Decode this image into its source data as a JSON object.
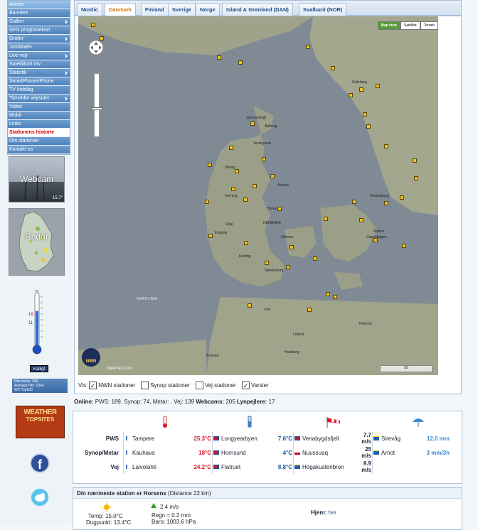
{
  "menu": {
    "items": [
      {
        "label": "Avisen",
        "arrow": false
      },
      {
        "label": "Bannere",
        "arrow": false
      },
      {
        "label": "Galleri",
        "arrow": true
      },
      {
        "label": "GFS prognosekort",
        "arrow": false
      },
      {
        "label": "Grafer",
        "arrow": true
      },
      {
        "label": "Jordskælv",
        "arrow": false
      },
      {
        "label": "Live vejr",
        "arrow": true
      },
      {
        "label": "Satellitkort mv.",
        "arrow": false
      },
      {
        "label": "Statistik",
        "arrow": true
      },
      {
        "label": "SmartPhone/iPhone",
        "arrow": false
      },
      {
        "label": "TV Indslag",
        "arrow": false
      },
      {
        "label": "Tilmeldte vejrsider",
        "arrow": true
      },
      {
        "label": "Video",
        "arrow": false
      },
      {
        "label": "Mobil",
        "arrow": false
      },
      {
        "label": "Links",
        "arrow": false
      },
      {
        "label": "Stationens historie",
        "arrow": false,
        "highlight": true
      },
      {
        "label": "Om stationen",
        "arrow": false
      },
      {
        "label": "Kontakt os",
        "arrow": false
      }
    ]
  },
  "sidebar": {
    "webcam_label": "Webcam",
    "webcam_temp": "15.7°",
    "radar_label": "Radar",
    "thermometer": {
      "unit": "°C",
      "max_value": "16",
      "min_value": "11",
      "level_value": 15
    },
    "kalibrate_label": "Kalligt",
    "hits_today": "Hits today: 309",
    "avg_hits": "Average hits: 1064",
    "hits_footer": "WX Top100",
    "topsites_line1": "WEATHER",
    "topsites_line2": "TOPSITES",
    "facebook_icon": "f"
  },
  "tabs": [
    "Nordic",
    "Danmark",
    "Finland",
    "Sverige",
    "Norge",
    "Island & Grønland (DAN)",
    "Svalbard (NOR)"
  ],
  "active_tab": "Danmark",
  "map": {
    "maptypes": [
      "Map view",
      "Satellite",
      "Terrain"
    ],
    "active_maptype": "Map view",
    "copyright": "©NAVTEQ 2010",
    "logo_text": "NWN",
    "scale_label": "50",
    "labels": [
      "Jammerbugt",
      "Aalborg",
      "Vendsyssel",
      "Viborg",
      "Aarhus",
      "Vejle",
      "Esbjerg",
      "Odense",
      "Horsens",
      "DENMARK",
      "Copenhagen",
      "Malmö",
      "Helsingborg",
      "Göteborg",
      "Kiel",
      "Lübeck",
      "Hamburg",
      "Rostock",
      "Bremen",
      "NORTH SEA",
      "Sønderborg",
      "Kolding",
      "Herning"
    ]
  },
  "layers": {
    "prefix": "Vis:",
    "items": [
      {
        "label": "NWN stationer",
        "checked": true
      },
      {
        "label": "Synop stationer",
        "checked": false
      },
      {
        "label": "Vej stationer",
        "checked": false
      },
      {
        "label": "Varsler",
        "checked": true
      }
    ]
  },
  "online": {
    "label": "Online:",
    "text": "PWS: 189, Synop: 74, Metar: , Vej: 139",
    "webcams_label": "Webcams:",
    "webcams_value": "205",
    "lightning_label": "Lynpejlere:",
    "lightning_value": "17"
  },
  "stats": {
    "icons": [
      "thermometer-icon",
      "rain-gauge-icon",
      "windsock-icon",
      "umbrella-icon"
    ],
    "rows": [
      {
        "label": "PWS",
        "temp_hi": {
          "flag": "fi",
          "station": "Tampere",
          "value": "25.3°C"
        },
        "temp_lo": {
          "flag": "no",
          "station": "Longyearbyen",
          "value": "7.6°C"
        },
        "wind": {
          "flag": "no",
          "station": "Venabygdsfjell",
          "value": "7.7 m/s"
        },
        "rain": {
          "flag": "se",
          "station": "Sirevåg",
          "value": "12.0 mm"
        }
      },
      {
        "label": "Synop/Metar",
        "temp_hi": {
          "flag": "fi",
          "station": "Kauhava",
          "value": "18°C"
        },
        "temp_lo": {
          "flag": "no",
          "station": "Hornsund",
          "value": "4°C"
        },
        "wind": {
          "flag": "gl",
          "station": "Nuussuaq",
          "value": "25 m/s"
        },
        "rain": {
          "flag": "se",
          "station": "Arnot",
          "value": "3 mm/3h"
        }
      },
      {
        "label": "Vej",
        "temp_hi": {
          "flag": "fi",
          "station": "Laivolahti",
          "value": "24.2°C"
        },
        "temp_lo": {
          "flag": "no",
          "station": "Flatruet",
          "value": "8.8°C"
        },
        "wind": {
          "flag": "se",
          "station": "Högakustenbron",
          "value": "9.9 m/s"
        },
        "rain": {
          "flag": "",
          "station": "",
          "value": ""
        }
      }
    ]
  },
  "nearest": {
    "title": "Din nærmeste station er Horsens",
    "distance": "(Distance 22 km)",
    "temp": "Temp: 15.0°C",
    "dewpoint": "Dugpunkt: 13.4°C",
    "wind": "2.4 m/s",
    "rain": "Regn = 0.2 mm",
    "baro": "Baro: 1003.6 hPa",
    "home_label": "Hjem:",
    "home_link": "her"
  },
  "colors": {
    "accent": "#4f82bd",
    "tab_active": "#e07a00",
    "hot": "#e0142b",
    "cold": "#1b5aa3"
  }
}
